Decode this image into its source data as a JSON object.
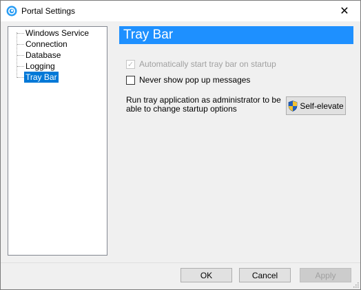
{
  "window": {
    "title": "Portal Settings",
    "app_icon": "portal-swirl-icon",
    "close_glyph": "✕"
  },
  "tree": {
    "items": [
      {
        "label": "Windows Service",
        "selected": false
      },
      {
        "label": "Connection",
        "selected": false
      },
      {
        "label": "Database",
        "selected": false
      },
      {
        "label": "Logging",
        "selected": false
      },
      {
        "label": "Tray Bar",
        "selected": true
      }
    ]
  },
  "panel": {
    "title": "Tray Bar",
    "options": [
      {
        "label": "Automatically start tray bar on startup",
        "checked": true,
        "enabled": false
      },
      {
        "label": "Never show pop up messages",
        "checked": false,
        "enabled": true
      }
    ],
    "admin_note": "Run tray application as administrator to be able to change startup options",
    "elevate_label": "Self-elevate",
    "elevate_icon": "uac-shield-icon"
  },
  "footer": {
    "ok_label": "OK",
    "cancel_label": "Cancel",
    "apply_label": "Apply"
  },
  "colors": {
    "header_bg": "#1e90ff",
    "selection_bg": "#0078d7"
  }
}
